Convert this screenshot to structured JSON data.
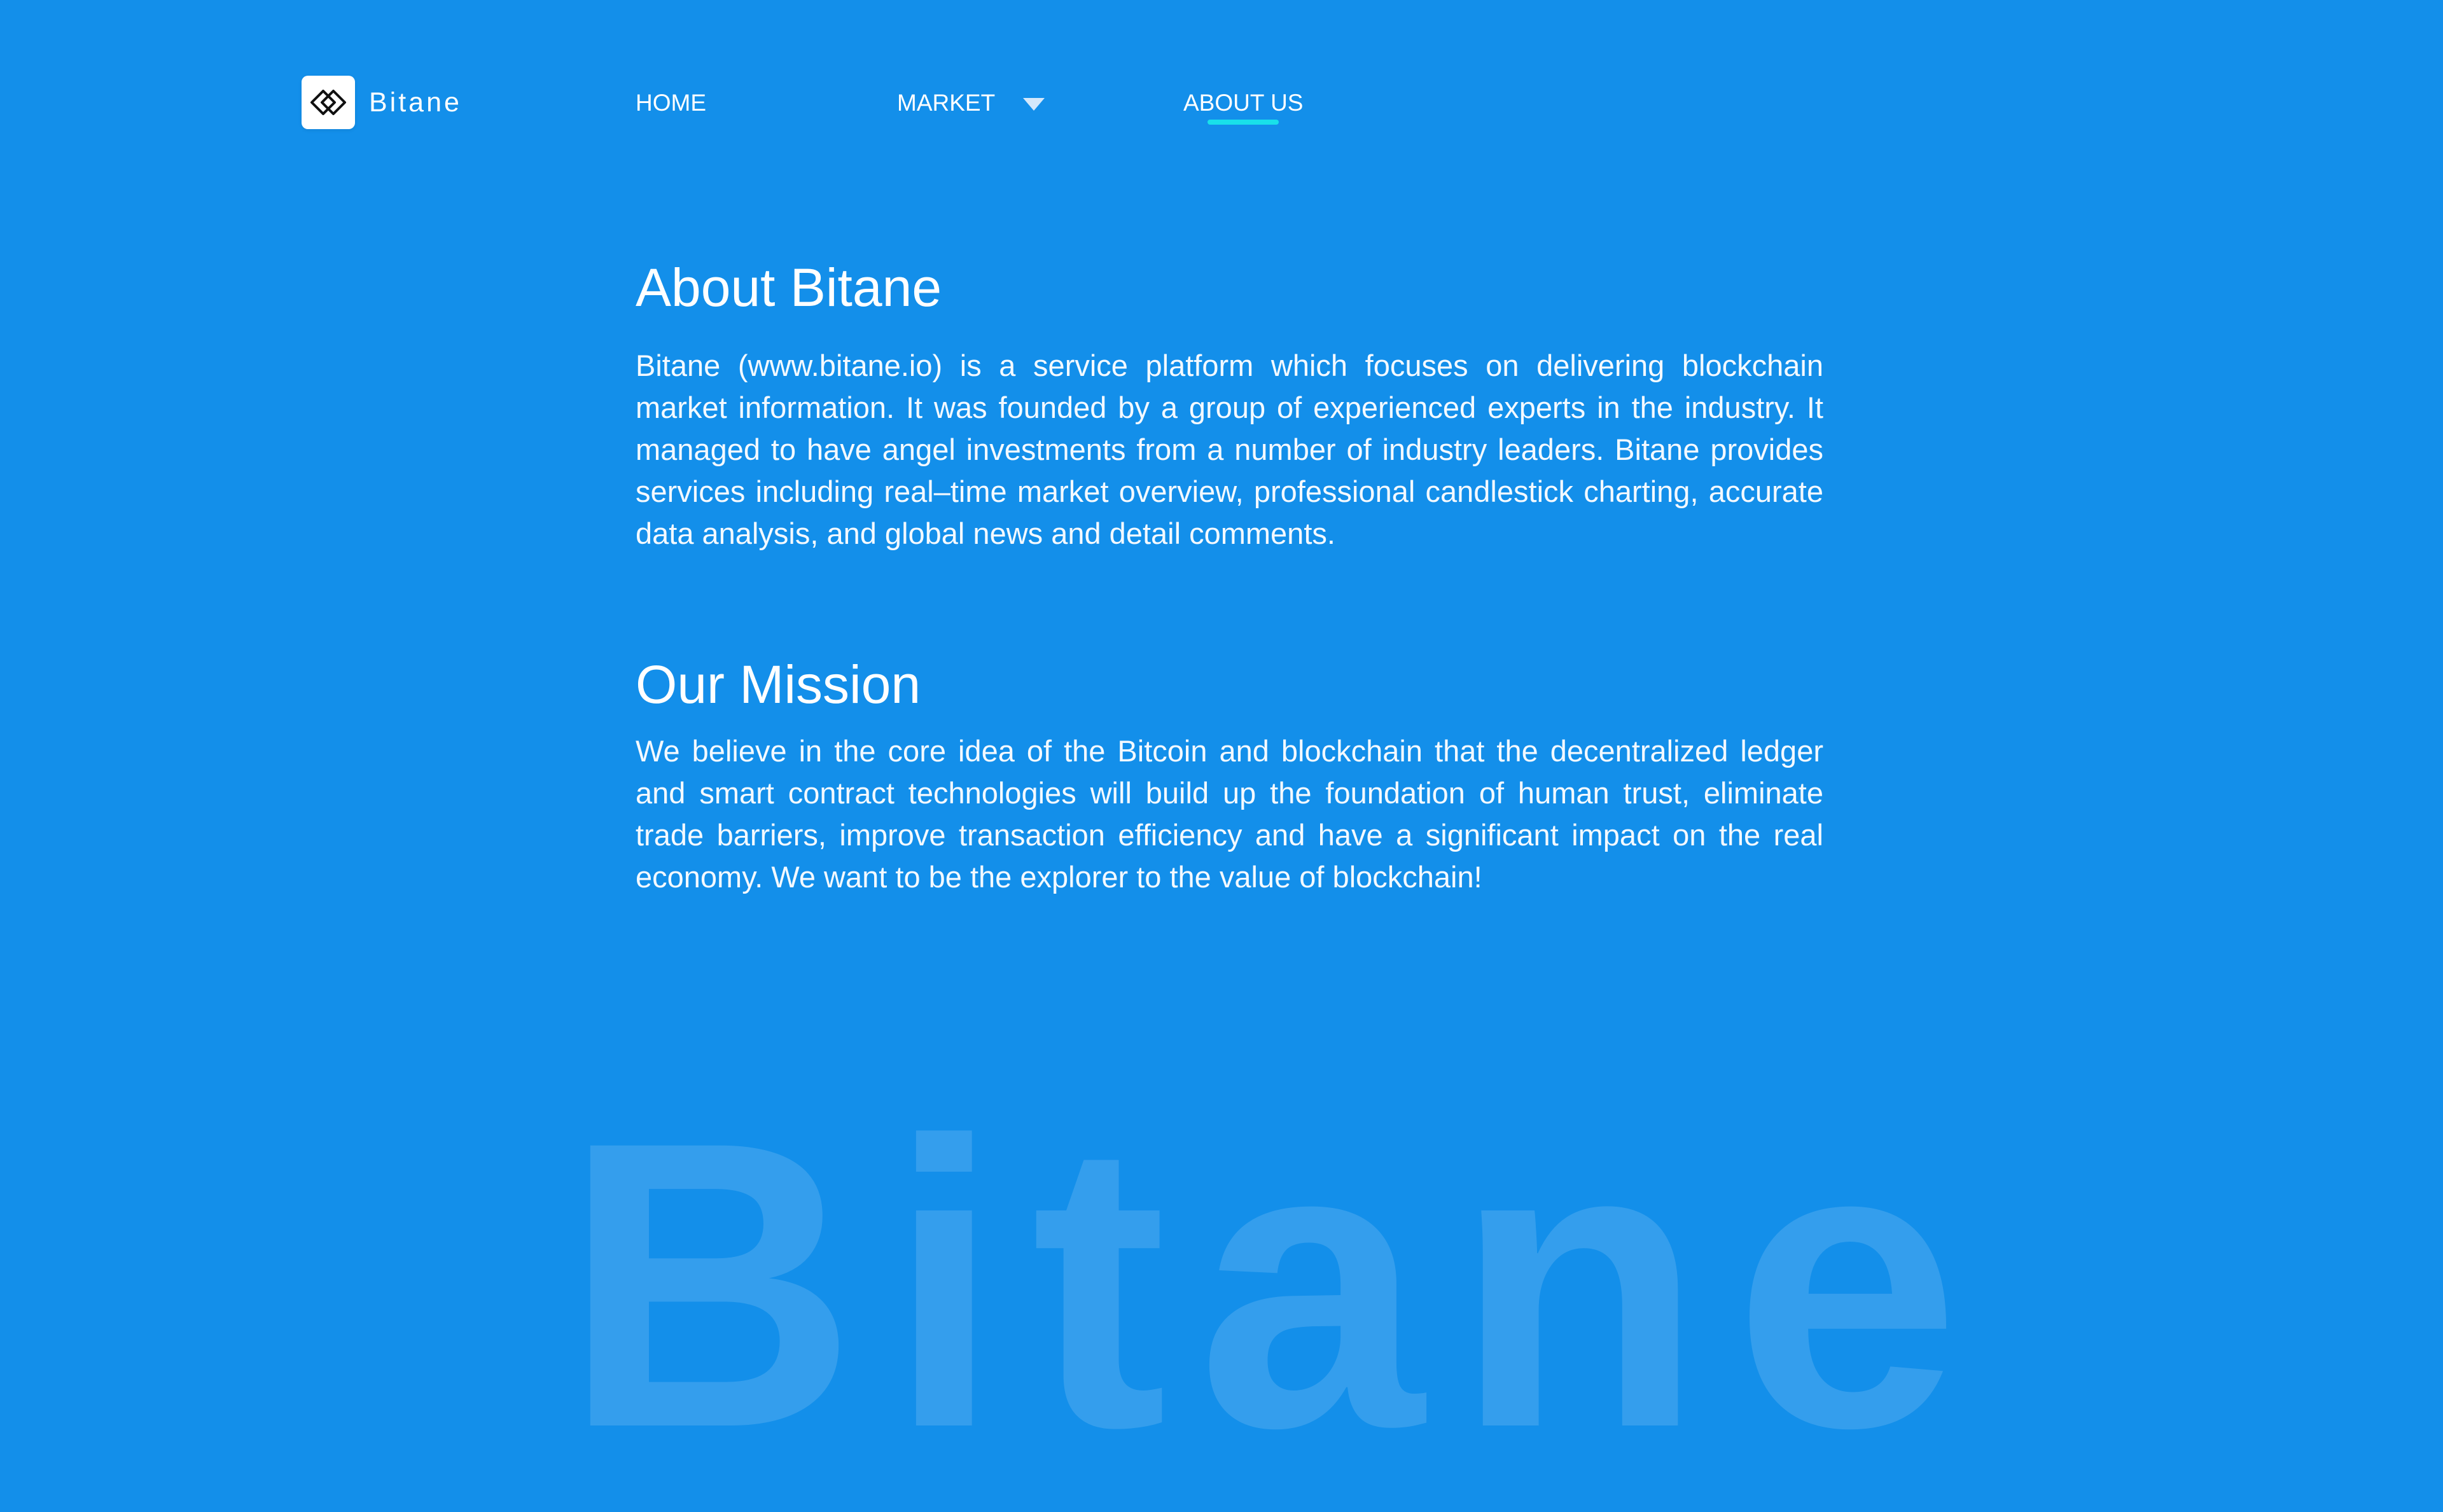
{
  "brand": {
    "name": "Bitane",
    "logo_icon": "bitane-diamond-logo-icon"
  },
  "nav": {
    "home": "HOME",
    "market": "MARKET",
    "market_icon": "chevron-down-icon",
    "about": "ABOUT US",
    "active": "ABOUT US",
    "underline_color": "#19e0ea"
  },
  "about": {
    "title": "About Bitane",
    "body": "Bitane (www.bitane.io) is a service platform which focuses on delivering blockchain market information. It was founded by a group of experienced experts in the industry. It managed to have angel investments from a number of industry leaders. Bitane provides services including real–time market overview, professional candlestick charting, accurate data analysis, and global news and detail comments."
  },
  "mission": {
    "title": "Our Mission",
    "body": "We believe in the core idea of the Bitcoin and blockchain that the decentralized ledger and smart contract technologies will build up the foundation of human trust, eliminate trade barriers, improve transaction efficiency and have a significant impact on the real economy. We want to be the explorer to the value of blockchain!"
  },
  "watermark": "Bitane",
  "colors": {
    "background": "#138fea",
    "text": "#ffffff",
    "accent": "#19e0ea"
  }
}
